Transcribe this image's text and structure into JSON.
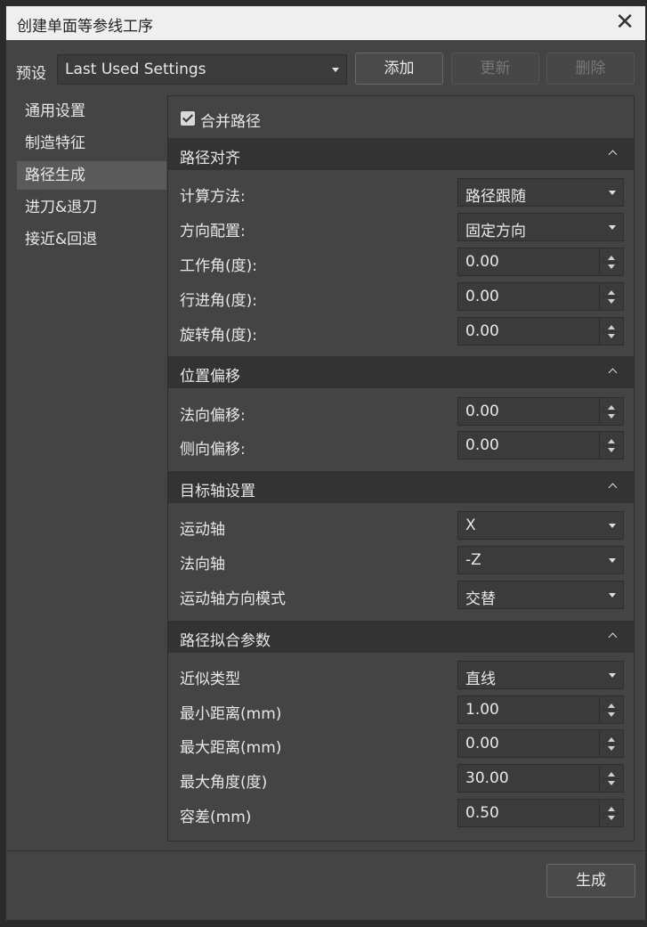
{
  "window": {
    "title": "创建单面等参线工序",
    "close_glyph": "✕"
  },
  "preset": {
    "label": "预设",
    "value": "Last Used Settings",
    "add_label": "添加",
    "update_label": "更新",
    "delete_label": "删除"
  },
  "nav": {
    "items": [
      {
        "label": "通用设置"
      },
      {
        "label": "制造特征"
      },
      {
        "label": "路径生成"
      },
      {
        "label": "进刀&退刀"
      },
      {
        "label": "接近&回退"
      }
    ],
    "active_index": 2
  },
  "panel": {
    "merge_path": {
      "label": "合并路径",
      "checked": true
    },
    "path_align": {
      "title": "路径对齐",
      "calc_method": {
        "label": "计算方法:",
        "value": "路径跟随"
      },
      "dir_config": {
        "label": "方向配置:",
        "value": "固定方向"
      },
      "work_angle": {
        "label": "工作角(度):",
        "value": "0.00"
      },
      "travel_angle": {
        "label": "行进角(度):",
        "value": "0.00"
      },
      "rotate_angle": {
        "label": "旋转角(度):",
        "value": "0.00"
      }
    },
    "pos_offset": {
      "title": "位置偏移",
      "normal_offset": {
        "label": "法向偏移:",
        "value": "0.00"
      },
      "side_offset": {
        "label": "侧向偏移:",
        "value": "0.00"
      }
    },
    "target_axis": {
      "title": "目标轴设置",
      "motion_axis": {
        "label": "运动轴",
        "value": "X"
      },
      "normal_axis": {
        "label": "法向轴",
        "value": "-Z"
      },
      "motion_dir_mode": {
        "label": "运动轴方向模式",
        "value": "交替"
      }
    },
    "path_fit": {
      "title": "路径拟合参数",
      "approx_type": {
        "label": "近似类型",
        "value": "直线"
      },
      "min_dist": {
        "label": "最小距离(mm)",
        "value": "1.00"
      },
      "max_dist": {
        "label": "最大距离(mm)",
        "value": "0.00"
      },
      "max_angle": {
        "label": "最大角度(度)",
        "value": "30.00"
      },
      "tolerance": {
        "label": "容差(mm)",
        "value": "0.50"
      }
    }
  },
  "footer": {
    "generate_label": "生成"
  }
}
